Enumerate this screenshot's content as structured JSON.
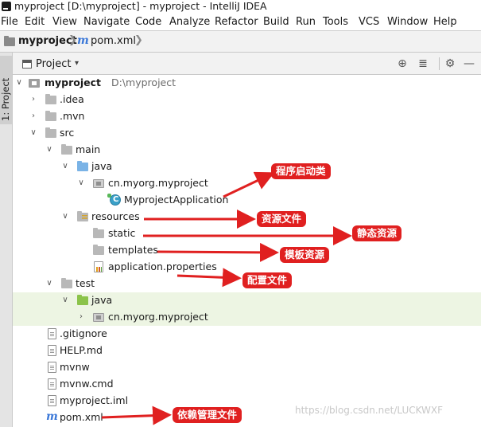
{
  "window": {
    "title": "myproject [D:\\myproject] - myproject - IntelliJ IDEA"
  },
  "menu": [
    "File",
    "Edit",
    "View",
    "Navigate",
    "Code",
    "Analyze",
    "Refactor",
    "Build",
    "Run",
    "Tools",
    "VCS",
    "Window",
    "Help"
  ],
  "breadcrumb": {
    "project": "myproject",
    "file": "pom.xml",
    "separator": "❯"
  },
  "sidebar": {
    "tab_label": "1: Project"
  },
  "panel": {
    "label": "Project",
    "dropdown": "▾",
    "tools": [
      "⊕",
      "≣",
      "⚙",
      "—"
    ]
  },
  "tree": [
    {
      "name": "myproject",
      "hint": "D:\\myproject",
      "arrow": "∨",
      "icon": "module"
    },
    {
      "name": ".idea",
      "arrow": "›",
      "icon": "folder"
    },
    {
      "name": ".mvn",
      "arrow": "›",
      "icon": "folder"
    },
    {
      "name": "src",
      "arrow": "∨",
      "icon": "folder"
    },
    {
      "name": "main",
      "arrow": "∨",
      "icon": "folder"
    },
    {
      "name": "java",
      "arrow": "∨",
      "icon": "source-folder"
    },
    {
      "name": "cn.myorg.myproject",
      "arrow": "∨",
      "icon": "package"
    },
    {
      "name": "MyprojectApplication",
      "arrow": "",
      "icon": "spring-class"
    },
    {
      "name": "resources",
      "arrow": "∨",
      "icon": "resources-folder"
    },
    {
      "name": "static",
      "arrow": "",
      "icon": "folder"
    },
    {
      "name": "templates",
      "arrow": "",
      "icon": "folder"
    },
    {
      "name": "application.properties",
      "arrow": "",
      "icon": "properties"
    },
    {
      "name": "test",
      "arrow": "∨",
      "icon": "folder"
    },
    {
      "name": "java",
      "arrow": "∨",
      "icon": "test-folder"
    },
    {
      "name": "cn.myorg.myproject",
      "arrow": "›",
      "icon": "package"
    },
    {
      "name": ".gitignore",
      "arrow": "",
      "icon": "file"
    },
    {
      "name": "HELP.md",
      "arrow": "",
      "icon": "file"
    },
    {
      "name": "mvnw",
      "arrow": "",
      "icon": "file"
    },
    {
      "name": "mvnw.cmd",
      "arrow": "",
      "icon": "file"
    },
    {
      "name": "myproject.iml",
      "arrow": "",
      "icon": "file"
    },
    {
      "name": "pom.xml",
      "arrow": "",
      "icon": "maven"
    }
  ],
  "annotations": {
    "startup_class": "程序启动类",
    "resource_files": "资源文件",
    "static_resources": "静态资源",
    "template_resources": "模板资源",
    "config_files": "配置文件",
    "dependency_management": "依赖管理文件"
  },
  "colors": {
    "annotation_bg": "#e02020",
    "test_row_bg": "#edf5e3",
    "maven_blue": "#3b78d8"
  },
  "watermark": "https://blog.csdn.net/LUCKWXF"
}
